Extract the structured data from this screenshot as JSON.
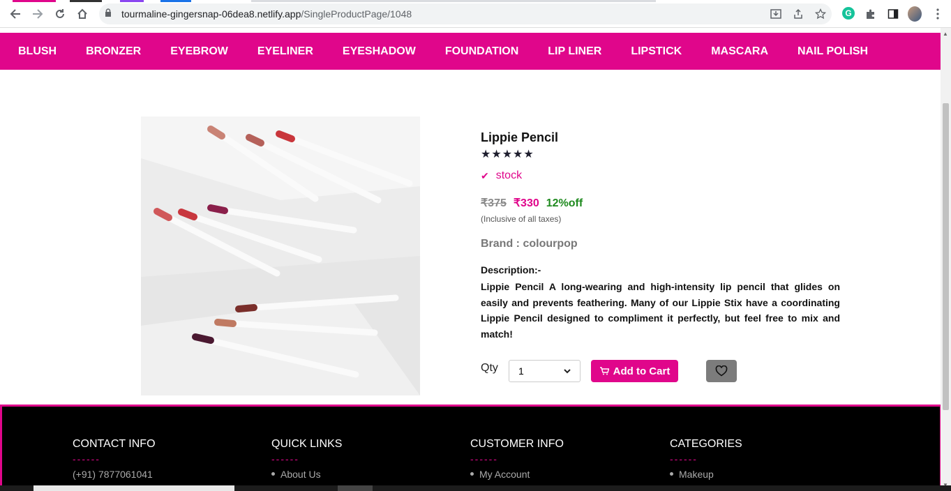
{
  "browser": {
    "url_host": "tourmaline-gingersnap-06dea8.netlify.app",
    "url_path": "/SingleProductPage/1048"
  },
  "categories": [
    "BLUSH",
    "BRONZER",
    "EYEBROW",
    "EYELINER",
    "EYESHADOW",
    "FOUNDATION",
    "LIP LINER",
    "LIPSTICK",
    "MASCARA",
    "NAIL POLISH"
  ],
  "product": {
    "title": "Lippie Pencil",
    "rating_stars": "★★★★★",
    "rating": 5,
    "stock_label": "stock",
    "mrp": "₹375",
    "price": "₹330",
    "discount": "12%off",
    "tax_note": "(Inclusive of all taxes)",
    "brand": "Brand : colourpop",
    "description_heading": "Description:-",
    "description": "Lippie Pencil A long-wearing and high-intensity lip pencil that glides on easily and prevents feathering. Many of our Lippie Stix have a coordinating Lippie Pencil designed to compliment it perfectly, but feel free to mix and match!"
  },
  "purchase": {
    "qty_label": "Qty",
    "qty_value": "1",
    "add_to_cart": "Add to Cart"
  },
  "footer": {
    "contact_heading": "CONTACT INFO",
    "contact_phone": "(+91) 7877061041",
    "links_heading": "QUICK LINKS",
    "links_item": "About Us",
    "customer_heading": "CUSTOMER INFO",
    "customer_item": "My Account",
    "categories_heading": "CATEGORIES",
    "categories_item": "Makeup",
    "divider": "------"
  },
  "colors": {
    "accent": "#e0068b",
    "discount_green": "#1f8a1f",
    "footer_bg": "#000000"
  }
}
